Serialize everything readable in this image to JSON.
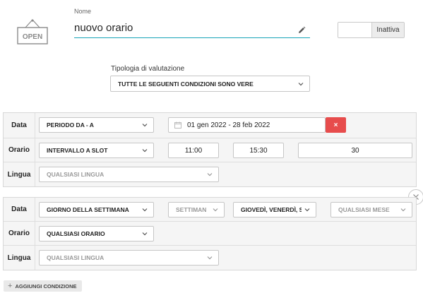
{
  "header": {
    "name_label": "Nome",
    "name_value": "nuovo orario",
    "status_toggle_label": "Inattiva"
  },
  "evaluation": {
    "label": "Tipologia di valutazione",
    "value": "TUTTE LE SEGUENTI CONDIZIONI SONO VERE"
  },
  "conditions": [
    {
      "rows": [
        {
          "label": "Data",
          "type_value": "PERIODO DA - A",
          "date_range": "01 gen 2022 - 28 feb 2022",
          "delete_label": "×"
        },
        {
          "label": "Orario",
          "type_value": "INTERVALLO A SLOT",
          "start_time": "11:00",
          "end_time": "15:30",
          "slot_minutes": "30"
        },
        {
          "label": "Lingua",
          "language_placeholder": "QUALSIASI LINGUA"
        }
      ]
    },
    {
      "rows": [
        {
          "label": "Data",
          "type_value": "GIORNO DELLA SETTIMANA",
          "week_placeholder": "SETTIMAN",
          "days_value": "GIOVEDÌ, VENERDÌ, SA",
          "month_placeholder": "QUALSIASI MESE"
        },
        {
          "label": "Orario",
          "type_value": "QUALSIASI ORARIO"
        },
        {
          "label": "Lingua",
          "language_placeholder": "QUALSIASI LINGUA"
        }
      ]
    }
  ],
  "actions": {
    "add_condition_label": "AGGIUNGI CONDIZIONE"
  },
  "icons": {
    "sign": "open-sign-icon",
    "edit": "pencil-icon",
    "calendar": "calendar-icon",
    "close": "close-icon",
    "chevron": "chevron-down-icon",
    "add": "plus-icon"
  },
  "colors": {
    "accent": "#19a5b8",
    "danger": "#e74c4c"
  }
}
